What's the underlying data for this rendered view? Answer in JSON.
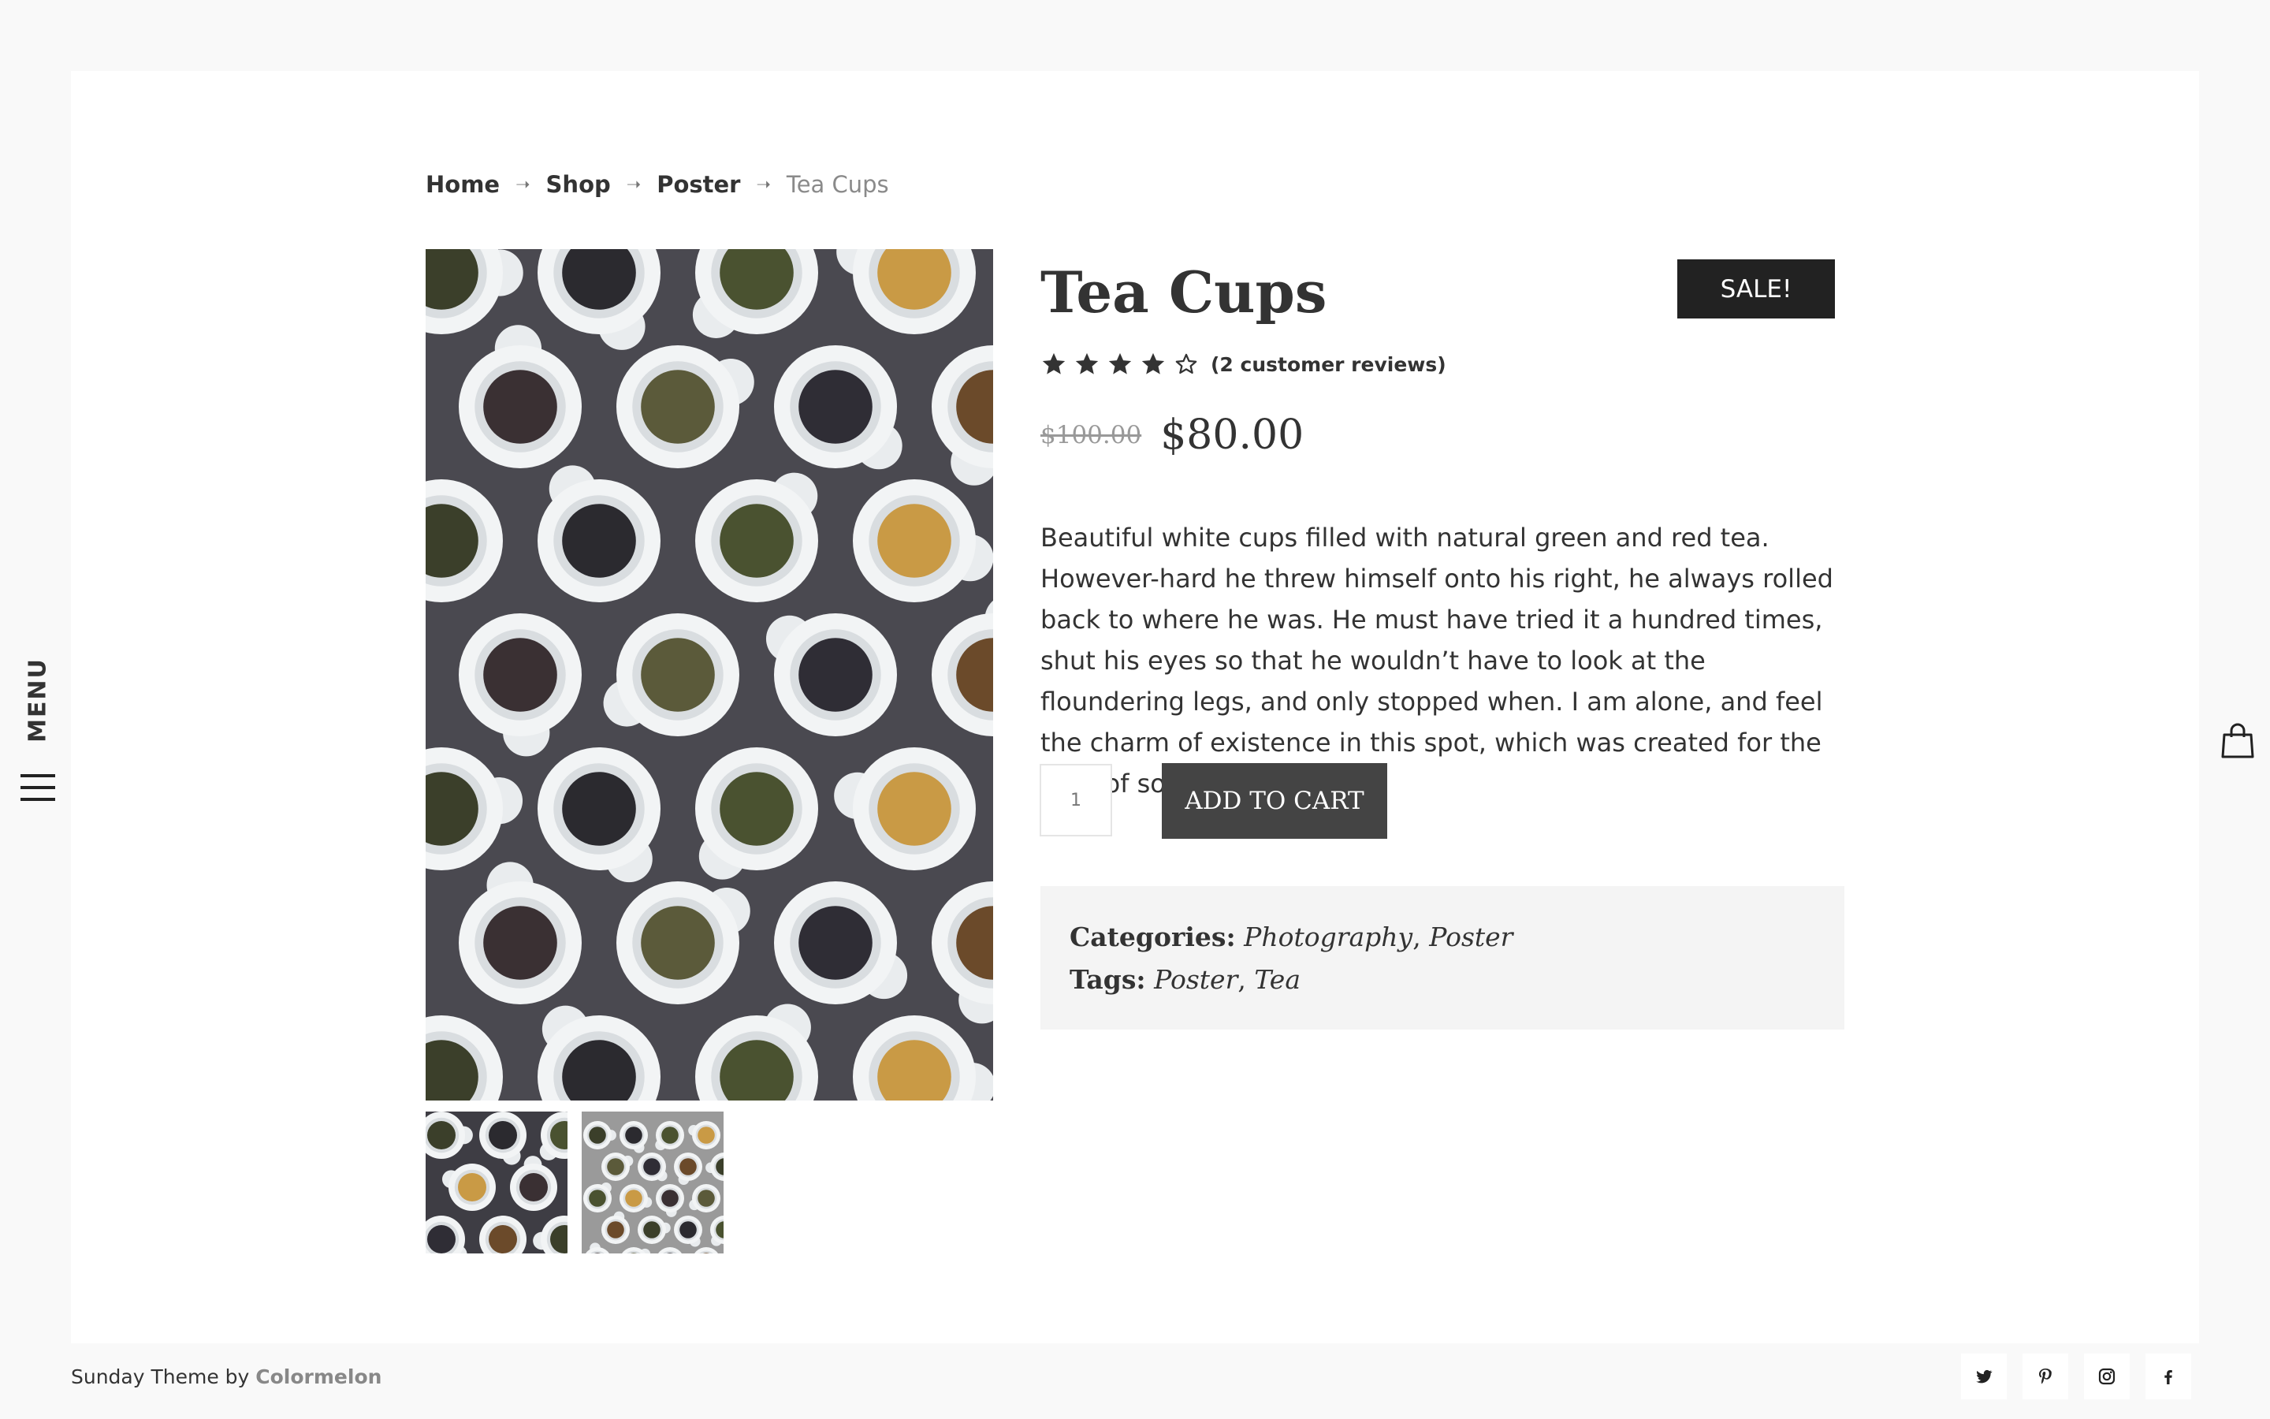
{
  "side_menu": {
    "label": "MENU"
  },
  "breadcrumb": {
    "items": [
      {
        "label": "Home"
      },
      {
        "label": "Shop"
      },
      {
        "label": "Poster"
      },
      {
        "label": "Tea Cups"
      }
    ],
    "separator": "➝"
  },
  "product": {
    "title": "Tea Cups",
    "badge": "SALE!",
    "rating": {
      "value": 4,
      "max": 5,
      "review_text": "(2 customer reviews)"
    },
    "price_old": "$100.00",
    "price_new": "$80.00",
    "description": "Beautiful white cups filled with natural green and red tea. However-hard he threw himself onto his right, he always rolled back to where he was. He must have tried it a hundred times, shut his eyes so that he wouldn’t have to look at the floundering legs, and only stopped when. I am alone, and feel the charm of existence in this spot, which was created for the bliss of souls like mine.",
    "quantity": "1",
    "add_to_cart_label": "ADD TO CART",
    "categories_label": "Categories:",
    "categories": [
      "Photography",
      "Poster"
    ],
    "tags_label": "Tags:",
    "tags": [
      "Poster",
      "Tea"
    ]
  },
  "footer": {
    "credit_prefix": "Sunday Theme by ",
    "credit_brand": "Colormelon",
    "social_icons": [
      "twitter-icon",
      "pinterest-icon",
      "instagram-icon",
      "facebook-icon"
    ]
  },
  "colors": {
    "page_background": "#f9f9f9",
    "card_background": "#ffffff",
    "badge_background": "#222222",
    "button_background": "#444444",
    "meta_background": "#f4f4f4",
    "muted_text": "#8a8a8a"
  }
}
